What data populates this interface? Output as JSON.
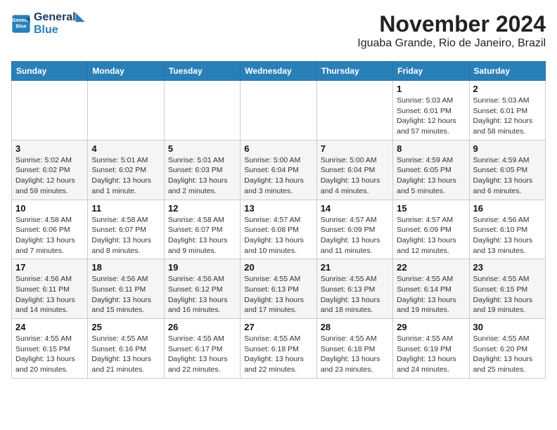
{
  "header": {
    "logo_line1": "General",
    "logo_line2": "Blue",
    "month": "November 2024",
    "location": "Iguaba Grande, Rio de Janeiro, Brazil"
  },
  "weekdays": [
    "Sunday",
    "Monday",
    "Tuesday",
    "Wednesday",
    "Thursday",
    "Friday",
    "Saturday"
  ],
  "weeks": [
    [
      {
        "day": "",
        "info": ""
      },
      {
        "day": "",
        "info": ""
      },
      {
        "day": "",
        "info": ""
      },
      {
        "day": "",
        "info": ""
      },
      {
        "day": "",
        "info": ""
      },
      {
        "day": "1",
        "info": "Sunrise: 5:03 AM\nSunset: 6:01 PM\nDaylight: 12 hours and 57 minutes."
      },
      {
        "day": "2",
        "info": "Sunrise: 5:03 AM\nSunset: 6:01 PM\nDaylight: 12 hours and 58 minutes."
      }
    ],
    [
      {
        "day": "3",
        "info": "Sunrise: 5:02 AM\nSunset: 6:02 PM\nDaylight: 12 hours and 59 minutes."
      },
      {
        "day": "4",
        "info": "Sunrise: 5:01 AM\nSunset: 6:02 PM\nDaylight: 13 hours and 1 minute."
      },
      {
        "day": "5",
        "info": "Sunrise: 5:01 AM\nSunset: 6:03 PM\nDaylight: 13 hours and 2 minutes."
      },
      {
        "day": "6",
        "info": "Sunrise: 5:00 AM\nSunset: 6:04 PM\nDaylight: 13 hours and 3 minutes."
      },
      {
        "day": "7",
        "info": "Sunrise: 5:00 AM\nSunset: 6:04 PM\nDaylight: 13 hours and 4 minutes."
      },
      {
        "day": "8",
        "info": "Sunrise: 4:59 AM\nSunset: 6:05 PM\nDaylight: 13 hours and 5 minutes."
      },
      {
        "day": "9",
        "info": "Sunrise: 4:59 AM\nSunset: 6:05 PM\nDaylight: 13 hours and 6 minutes."
      }
    ],
    [
      {
        "day": "10",
        "info": "Sunrise: 4:58 AM\nSunset: 6:06 PM\nDaylight: 13 hours and 7 minutes."
      },
      {
        "day": "11",
        "info": "Sunrise: 4:58 AM\nSunset: 6:07 PM\nDaylight: 13 hours and 8 minutes."
      },
      {
        "day": "12",
        "info": "Sunrise: 4:58 AM\nSunset: 6:07 PM\nDaylight: 13 hours and 9 minutes."
      },
      {
        "day": "13",
        "info": "Sunrise: 4:57 AM\nSunset: 6:08 PM\nDaylight: 13 hours and 10 minutes."
      },
      {
        "day": "14",
        "info": "Sunrise: 4:57 AM\nSunset: 6:09 PM\nDaylight: 13 hours and 11 minutes."
      },
      {
        "day": "15",
        "info": "Sunrise: 4:57 AM\nSunset: 6:09 PM\nDaylight: 13 hours and 12 minutes."
      },
      {
        "day": "16",
        "info": "Sunrise: 4:56 AM\nSunset: 6:10 PM\nDaylight: 13 hours and 13 minutes."
      }
    ],
    [
      {
        "day": "17",
        "info": "Sunrise: 4:56 AM\nSunset: 6:11 PM\nDaylight: 13 hours and 14 minutes."
      },
      {
        "day": "18",
        "info": "Sunrise: 4:56 AM\nSunset: 6:11 PM\nDaylight: 13 hours and 15 minutes."
      },
      {
        "day": "19",
        "info": "Sunrise: 4:56 AM\nSunset: 6:12 PM\nDaylight: 13 hours and 16 minutes."
      },
      {
        "day": "20",
        "info": "Sunrise: 4:55 AM\nSunset: 6:13 PM\nDaylight: 13 hours and 17 minutes."
      },
      {
        "day": "21",
        "info": "Sunrise: 4:55 AM\nSunset: 6:13 PM\nDaylight: 13 hours and 18 minutes."
      },
      {
        "day": "22",
        "info": "Sunrise: 4:55 AM\nSunset: 6:14 PM\nDaylight: 13 hours and 19 minutes."
      },
      {
        "day": "23",
        "info": "Sunrise: 4:55 AM\nSunset: 6:15 PM\nDaylight: 13 hours and 19 minutes."
      }
    ],
    [
      {
        "day": "24",
        "info": "Sunrise: 4:55 AM\nSunset: 6:15 PM\nDaylight: 13 hours and 20 minutes."
      },
      {
        "day": "25",
        "info": "Sunrise: 4:55 AM\nSunset: 6:16 PM\nDaylight: 13 hours and 21 minutes."
      },
      {
        "day": "26",
        "info": "Sunrise: 4:55 AM\nSunset: 6:17 PM\nDaylight: 13 hours and 22 minutes."
      },
      {
        "day": "27",
        "info": "Sunrise: 4:55 AM\nSunset: 6:18 PM\nDaylight: 13 hours and 22 minutes."
      },
      {
        "day": "28",
        "info": "Sunrise: 4:55 AM\nSunset: 6:18 PM\nDaylight: 13 hours and 23 minutes."
      },
      {
        "day": "29",
        "info": "Sunrise: 4:55 AM\nSunset: 6:19 PM\nDaylight: 13 hours and 24 minutes."
      },
      {
        "day": "30",
        "info": "Sunrise: 4:55 AM\nSunset: 6:20 PM\nDaylight: 13 hours and 25 minutes."
      }
    ]
  ]
}
